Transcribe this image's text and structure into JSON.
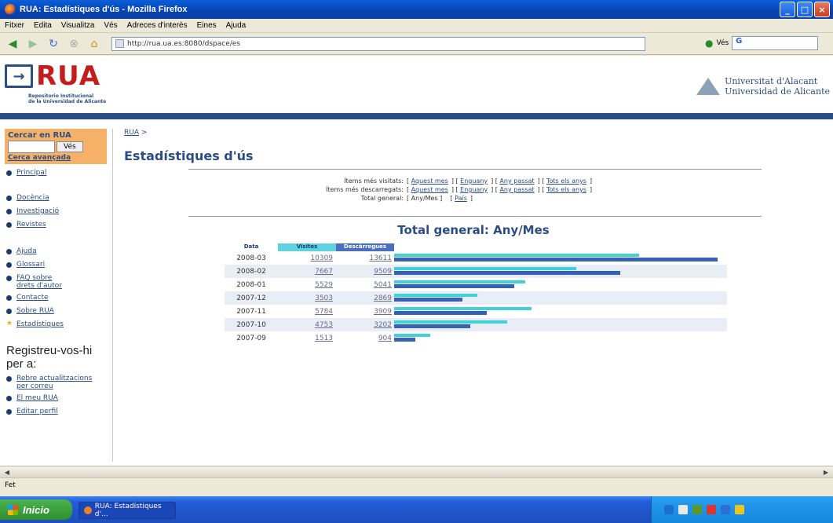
{
  "window": {
    "title": "RUA: Estadístiques d'ús - Mozilla Firefox"
  },
  "menu": [
    "Fitxer",
    "Edita",
    "Visualitza",
    "Vés",
    "Adreces d'interès",
    "Eines",
    "Ajuda"
  ],
  "nav": {
    "url": "http://rua.ua.es:8080/dspace/es",
    "go_label": "Vés",
    "search_value": "G"
  },
  "header": {
    "logo_text": "RUA",
    "logo_sub_1": "Repositorio Institucional",
    "logo_sub_2": "de la Universidad de Alicante",
    "univ_1": "Universitat d'Alacant",
    "univ_2": "Universidad de Alicante"
  },
  "sidebar": {
    "search_label": "Cercar en RUA",
    "search_button": "Vés",
    "advanced": "Cerca avançada",
    "items_1": [
      "Principal"
    ],
    "items_2": [
      "Docència",
      "Investigació",
      "Revistes"
    ],
    "items_3": [
      "Ajuda",
      "Glossari",
      "FAQ sobre drets d'autor",
      "Contacte",
      "Sobre RUA",
      "Estadístiques"
    ],
    "register_title": "Registreu-vos-hi per a:",
    "register_items": [
      "Rebre actualitzacions per correu",
      "El meu RUA",
      "Editar perfil"
    ]
  },
  "main": {
    "breadcrumb": "RUA",
    "breadcrumb_sep": ">",
    "title": "Estadístiques d'ús",
    "row1_key": "Ítems més visitats:",
    "row2_key": "Ítems més descarregats:",
    "row3_key": "Total general:",
    "links_period": [
      "Aquest mes",
      "Enguany",
      "Any passat",
      "Tots els anys"
    ],
    "row3_links": [
      "Any/Mes",
      "País"
    ],
    "chart_title": "Total general: Any/Mes",
    "col_date": "Data",
    "col_visits": "Visites",
    "col_downloads": "Descàrregues"
  },
  "chart_data": {
    "type": "bar",
    "title": "Total general: Any/Mes",
    "categories": [
      "2008-03",
      "2008-02",
      "2008-01",
      "2007-12",
      "2007-11",
      "2007-10",
      "2007-09"
    ],
    "series": [
      {
        "name": "Visites",
        "values": [
          10309,
          7667,
          5529,
          3503,
          5784,
          4753,
          1513
        ]
      },
      {
        "name": "Descàrregues",
        "values": [
          13611,
          9509,
          5041,
          2869,
          3909,
          3202,
          904
        ]
      }
    ],
    "colors": {
      "visits": "#40d2da",
      "downloads": "#3761b3"
    }
  },
  "status": {
    "text": "Fet"
  },
  "taskbar": {
    "start": "Inicio",
    "task": "RUA: Estadístiques d'..."
  }
}
